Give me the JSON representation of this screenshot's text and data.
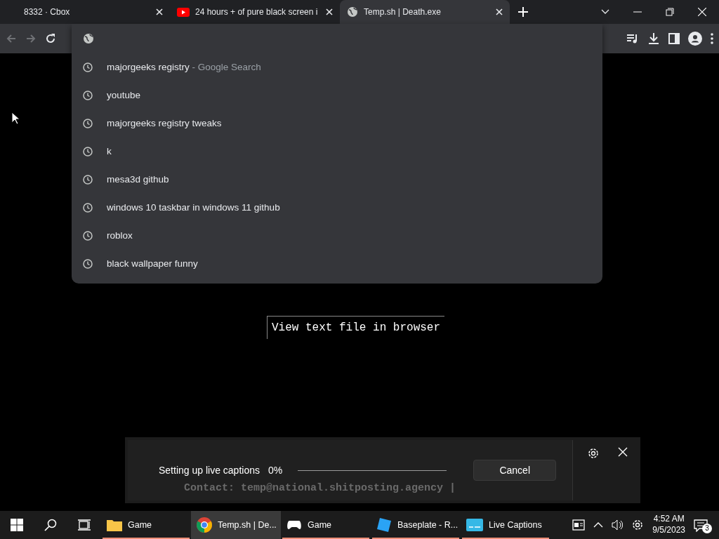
{
  "tabs": [
    {
      "title": "8332 · Cbox",
      "kind": "plain",
      "selected": false
    },
    {
      "title": "24 hours + of pure black screen i",
      "kind": "video",
      "selected": false
    },
    {
      "title": "Temp.sh | Death.exe",
      "kind": "page",
      "selected": true
    }
  ],
  "omnibox": {
    "suggestions": [
      {
        "text": "majorgeeks registry",
        "hint": "- Google Search"
      },
      {
        "text": "youtube"
      },
      {
        "text": "majorgeeks registry tweaks"
      },
      {
        "text": "k"
      },
      {
        "text": "mesa3d github"
      },
      {
        "text": "windows 10 taskbar in windows 11 github"
      },
      {
        "text": "roblox"
      },
      {
        "text": "black wallpaper funny"
      }
    ]
  },
  "page": {
    "link": "View text file in browser",
    "footer": "Contact: temp@national.shitposting.agency |"
  },
  "captions": {
    "status": "Setting up live captions",
    "percent": "0%",
    "level": 0,
    "cancel": "Cancel"
  },
  "taskbar": {
    "apps": [
      {
        "label": "Game",
        "kind": "folder",
        "selected": false,
        "flashing": true
      },
      {
        "label": "Temp.sh | De...",
        "kind": "chrome",
        "selected": true,
        "flashing": false
      },
      {
        "label": "Game",
        "kind": "gamepad",
        "selected": false,
        "flashing": true
      },
      {
        "label": "Baseplate - R...",
        "kind": "studio",
        "selected": false,
        "flashing": true
      },
      {
        "label": "Live Captions",
        "kind": "captions",
        "selected": false,
        "flashing": true
      }
    ],
    "time": "4:52 AM",
    "date": "9/5/2023",
    "notifications": "3"
  }
}
